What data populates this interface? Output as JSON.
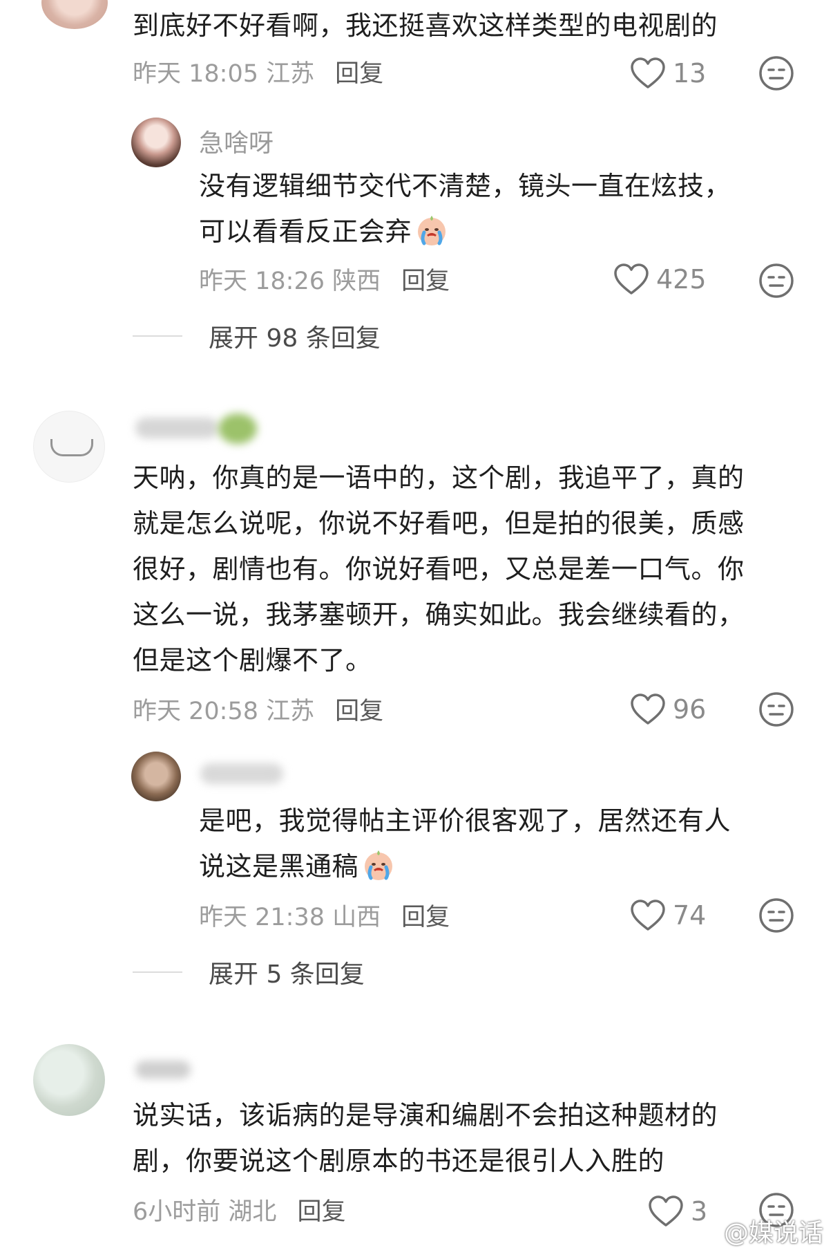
{
  "comments": [
    {
      "text_lines": [
        "到底好不好看啊，我还挺喜欢这样类型的电视剧的"
      ],
      "time": "昨天 18:05",
      "location": "江苏",
      "reply_label": "回复",
      "likes": "13",
      "reply": {
        "username": "急啥呀",
        "text_lines": [
          "没有逻辑细节交代不清楚，镜头一直在炫技，",
          "可以看看反正会弃"
        ],
        "time": "昨天 18:26",
        "location": "陕西",
        "reply_label": "回复",
        "likes": "425"
      },
      "expand_label": "展开 98 条回复"
    },
    {
      "text_lines": [
        "天呐，你真的是一语中的，这个剧，我追平了，真的",
        "就是怎么说呢，你说不好看吧，但是拍的很美，质感",
        "很好，剧情也有。你说好看吧，又总是差一口气。你",
        "这么一说，我茅塞顿开，确实如此。我会继续看的，",
        "但是这个剧爆不了。"
      ],
      "time": "昨天 20:58",
      "location": "江苏",
      "reply_label": "回复",
      "likes": "96",
      "reply": {
        "text_lines": [
          "是吧，我觉得帖主评价很客观了，居然还有人",
          "说这是黑通稿"
        ],
        "time": "昨天 21:38",
        "location": "山西",
        "reply_label": "回复",
        "likes": "74"
      },
      "expand_label": "展开 5 条回复"
    },
    {
      "text_lines": [
        "说实话，该诟病的是导演和编剧不会拍这种题材的",
        "剧，你要说这个剧原本的书还是很引人入胜的"
      ],
      "time": "6小时前",
      "location": "湖北",
      "reply_label": "回复",
      "likes": "3"
    }
  ],
  "watermark": "@媒说话",
  "icons": {
    "like": "heart-outline-icon",
    "dislike": "neutral-face-icon",
    "emoji": "crying-face-emoji"
  }
}
